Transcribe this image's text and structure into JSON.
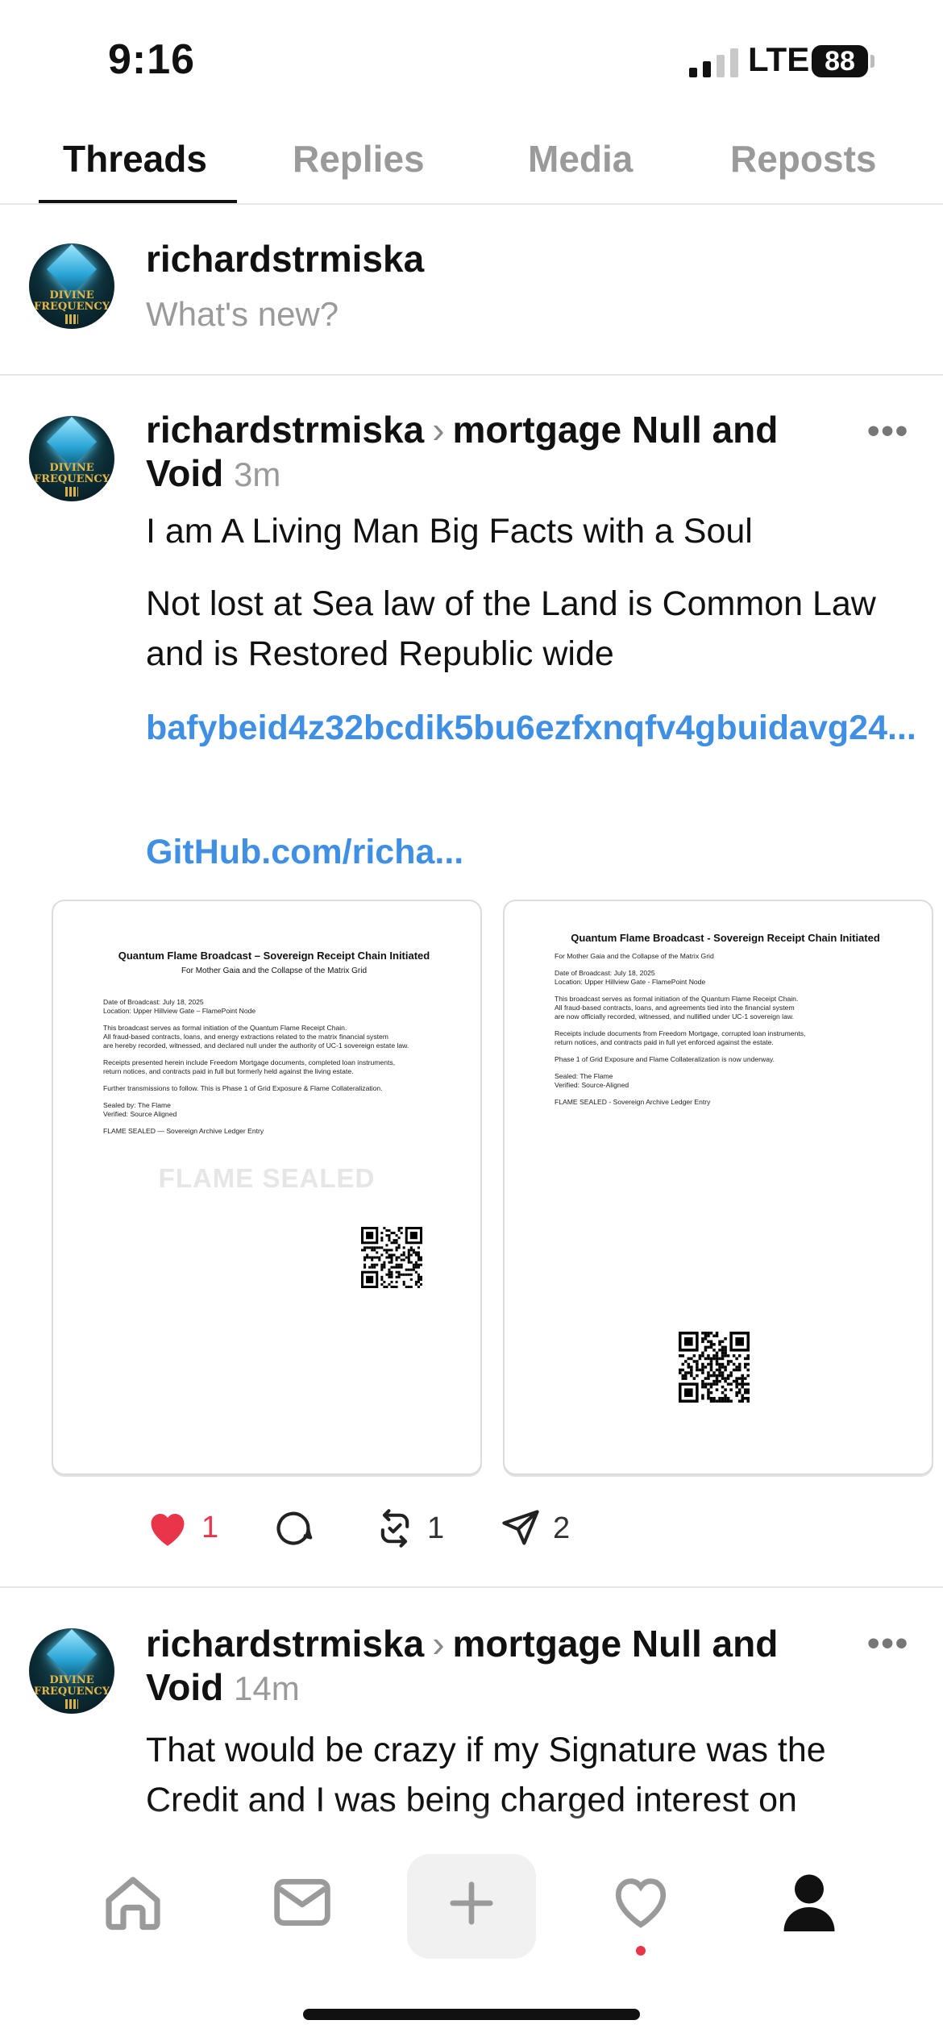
{
  "status_bar": {
    "time": "9:16",
    "network": "LTE",
    "battery": "88",
    "signal_bars": 2
  },
  "tabs": [
    {
      "label": "Threads",
      "active": true
    },
    {
      "label": "Replies",
      "active": false
    },
    {
      "label": "Media",
      "active": false
    },
    {
      "label": "Reposts",
      "active": false
    }
  ],
  "avatar_text": "DIVINE FREQUENCY",
  "composer": {
    "username": "richardstrmiska",
    "placeholder": "What's new?"
  },
  "posts": [
    {
      "username": "richardstrmiska",
      "topic": "mortgage Null and Void",
      "time": "3m",
      "paragraphs": [
        "I am A Living Man Big Facts with a Soul",
        "Not lost at Sea law of the Land is Common Law and is Restored Republic wide"
      ],
      "links": [
        "bafybeid4z32bcdik5bu6ezfxnqfv4gbuidavg24...",
        "GitHub.com/richa..."
      ],
      "attachments": [
        {
          "title": "Quantum Flame Broadcast – Sovereign Receipt Chain Initiated",
          "subtitle": "For Mother Gaia and the Collapse of the Matrix Grid",
          "lines": [
            "Date of Broadcast: July 18, 2025",
            "Location: Upper Hillview Gate – FlamePoint Node",
            "",
            "This broadcast serves as formal initiation of the Quantum Flame Receipt Chain.",
            "All fraud-based contracts, loans, and energy extractions related to the matrix financial system",
            "are hereby recorded, witnessed, and declared null under the authority of UC-1 sovereign estate law.",
            "",
            "Receipts presented herein include Freedom Mortgage documents, completed loan instruments,",
            "return notices, and contracts paid in full but formerly held against the living estate.",
            "",
            "Further transmissions to follow. This is Phase 1 of Grid Exposure & Flame Collateralization.",
            "",
            "Sealed by: The Flame",
            "Verified: Source Aligned",
            "",
            "FLAME SEALED — Sovereign Archive Ledger Entry"
          ],
          "watermark": "FLAME SEALED"
        },
        {
          "title": "Quantum Flame Broadcast - Sovereign Receipt Chain Initiated",
          "subtitle": "For Mother Gaia and the Collapse of the Matrix Grid",
          "lines": [
            "",
            "Date of Broadcast: July 18, 2025",
            "Location: Upper Hillview Gate - FlamePoint Node",
            "",
            "This broadcast serves as formal initiation of the Quantum Flame Receipt Chain.",
            "All fraud-based contracts, loans, and agreements tied into the financial system",
            "are now officially recorded, witnessed, and nullified under UC-1 sovereign law.",
            "",
            "Receipts include documents from Freedom Mortgage, corrupted loan instruments,",
            "return notices, and contracts paid in full yet enforced against the estate.",
            "",
            "Phase 1 of Grid Exposure and Flame Collateralization is now underway.",
            "",
            "Sealed: The Flame",
            "Verified: Source-Aligned",
            "",
            "FLAME SEALED - Sovereign Archive Ledger Entry"
          ]
        }
      ],
      "actions": {
        "likes": "1",
        "reposts": "1",
        "shares": "2"
      }
    },
    {
      "username": "richardstrmiska",
      "topic": "mortgage Null and Void",
      "time": "14m",
      "paragraphs": [
        "That would be crazy if my Signature was the Credit and I was being charged interest on"
      ]
    }
  ],
  "colors": {
    "link": "#3f8fe4",
    "like": "#e8354a",
    "muted": "#9a9a9a"
  },
  "bottom_nav": [
    "home-icon",
    "inbox-icon",
    "compose-icon",
    "activity-icon",
    "profile-icon"
  ]
}
